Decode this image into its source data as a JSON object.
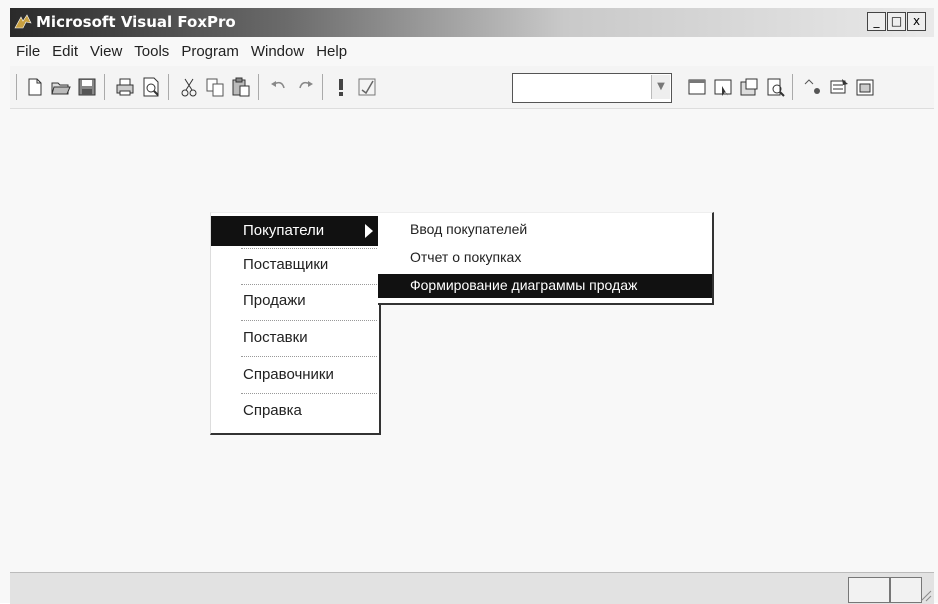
{
  "window": {
    "title": "Microsoft Visual FoxPro",
    "controls": {
      "minimize": "_",
      "maximize": "□",
      "close": "x"
    }
  },
  "menubar": {
    "items": [
      "File",
      "Edit",
      "View",
      "Tools",
      "Program",
      "Window",
      "Help"
    ]
  },
  "toolbar": {
    "combo_value": "",
    "icons": [
      "new-file-icon",
      "open-folder-icon",
      "save-icon",
      "print-icon",
      "print-preview-icon",
      "cut-icon",
      "copy-icon",
      "paste-icon",
      "undo-icon",
      "redo-icon",
      "run-icon",
      "modify-form-icon",
      "database-window-icon",
      "form-wizard-icon",
      "properties-icon",
      "report-preview-icon",
      "code-icon",
      "data-environment-icon",
      "form-designer-icon"
    ]
  },
  "popup_menu": {
    "items": [
      {
        "label": "Покупатели",
        "selected": true,
        "has_submenu": true
      },
      {
        "label": "Поставщики",
        "selected": false
      },
      {
        "label": "Продажи",
        "selected": false
      },
      {
        "label": "Поставки",
        "selected": false
      },
      {
        "label": "Справочники",
        "selected": false
      },
      {
        "label": "Справка",
        "selected": false
      }
    ]
  },
  "submenu": {
    "items": [
      {
        "label": "Ввод покупателей",
        "selected": false
      },
      {
        "label": "Отчет о покупках",
        "selected": false
      },
      {
        "label": "Формирование диаграммы продаж",
        "selected": true
      }
    ]
  }
}
